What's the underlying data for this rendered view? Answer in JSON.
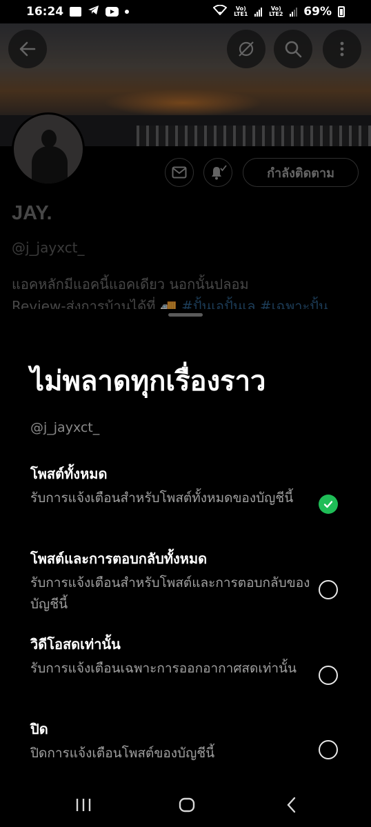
{
  "status": {
    "time": "16:24",
    "lte1": "Vo) LTE1",
    "lte2": "Vo) LTE2",
    "battery": "69%",
    "notification_icons": [
      "gallery-icon",
      "telegram-icon",
      "youtube-icon",
      "dot-icon"
    ]
  },
  "header": {
    "back_icon": "arrow-left-icon",
    "actions": [
      "grok-icon",
      "search-icon",
      "more-vertical-icon"
    ]
  },
  "profile": {
    "name": "JAY.",
    "handle": "@j_jayxct_",
    "bio_line1": "แอคหลักมีแอคนี้แอคเดียว นอกนั้นปลอม",
    "bio_line2_text": "Review-ส่งการบ้านได้ที่ ",
    "bio_line2_tags": "#ปั้นเอปั้นเล #เฉพาะปั้น",
    "message_icon": "mail-icon",
    "bell_icon": "bell-check-icon",
    "follow_label": "กำลังติดตาม"
  },
  "sheet": {
    "title": "ไม่พลาดทุกเรื่องราว",
    "handle": "@j_jayxct_",
    "options": [
      {
        "title": "โพสต์ทั้งหมด",
        "desc": "รับการแจ้งเตือนสำหรับโพสต์ทั้งหมดของบัญชีนี้",
        "selected": true
      },
      {
        "title": "โพสต์และการตอบกลับทั้งหมด",
        "desc": "รับการแจ้งเตือนสำหรับโพสต์และการตอบกลับของบัญชีนี้",
        "selected": false
      },
      {
        "title": "วิดีโอสดเท่านั้น",
        "desc": "รับการแจ้งเตือนเฉพาะการออกอากาศสดเท่านั้น",
        "selected": false
      },
      {
        "title": "ปิด",
        "desc": "ปิดการแจ้งเตือนโพสต์ของบัญชีนี้",
        "selected": false
      }
    ]
  },
  "navbar": [
    "recents-icon",
    "home-icon",
    "back-chevron-icon"
  ],
  "colors": {
    "accent_green": "#1fbd57",
    "link_blue": "#2c5c86"
  }
}
